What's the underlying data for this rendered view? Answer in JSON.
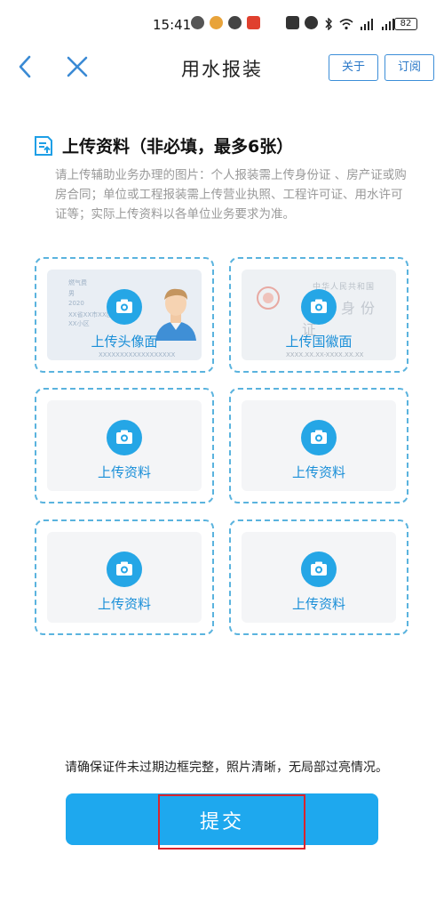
{
  "status_bar": {
    "time": "15:41",
    "battery": "82",
    "icons_left": [
      "heart-app-icon",
      "weibo-icon",
      "chat-bubble-icon",
      "red-app-icon"
    ],
    "icons_right": [
      "nfc-icon",
      "alarm-icon",
      "bluetooth-icon",
      "wifi-icon",
      "signal-5g-icon",
      "signal-4g-icon",
      "battery-icon"
    ]
  },
  "nav": {
    "title": "用水报装",
    "about_label": "关于",
    "subscribe_label": "订阅",
    "back_icon": "chevron-left-icon",
    "close_icon": "close-icon"
  },
  "upload": {
    "title": "上传资料（非必填，最多6张）",
    "description": "请上传辅助业务办理的图片：个人报装需上传身份证 、房产证或购房合同；单位或工程报装需上传营业执照、工程许可证、用水许可证等；实际上传资料以各单位业务要求为准。",
    "slots": [
      {
        "label": "上传头像面"
      },
      {
        "label": "上传国徽面"
      },
      {
        "label": "上传资料"
      },
      {
        "label": "上传资料"
      },
      {
        "label": "上传资料"
      },
      {
        "label": "上传资料"
      }
    ],
    "id_front_sample": {
      "row1": "燃气费",
      "row2": "男",
      "row3": "2020",
      "row4": "XX省XX市XX区XX街",
      "row5": "XX小区",
      "id_number": "XXXXXXXXXXXXXXXXXX"
    },
    "id_back_sample": {
      "line1": "中华人民共和国",
      "line2": "居民身份证",
      "validity": "XXXX.XX.XX-XXXX.XX.XX"
    }
  },
  "notice": "请确保证件未过期边框完整，照片清晰，无局部过亮情况。",
  "submit_label": "提交",
  "colors": {
    "primary": "#1ea8ee",
    "accent_border": "#5ab3de",
    "highlight": "#d9242d"
  }
}
